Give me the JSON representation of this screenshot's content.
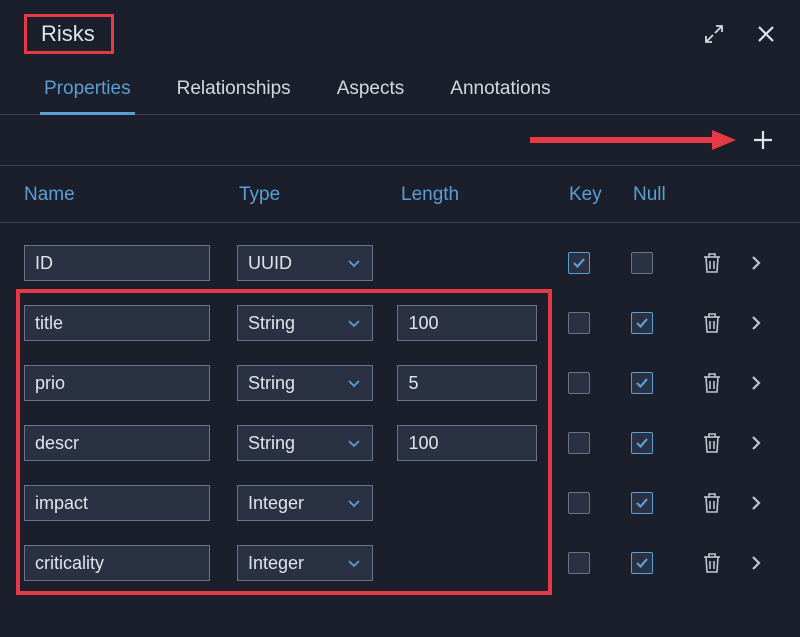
{
  "header": {
    "title": "Risks"
  },
  "tabs": [
    {
      "label": "Properties",
      "active": true
    },
    {
      "label": "Relationships",
      "active": false
    },
    {
      "label": "Aspects",
      "active": false
    },
    {
      "label": "Annotations",
      "active": false
    }
  ],
  "columns": {
    "name": "Name",
    "type": "Type",
    "length": "Length",
    "key": "Key",
    "null": "Null"
  },
  "rows": [
    {
      "name": "ID",
      "type": "UUID",
      "length": "",
      "key": true,
      "null": false
    },
    {
      "name": "title",
      "type": "String",
      "length": "100",
      "key": false,
      "null": true
    },
    {
      "name": "prio",
      "type": "String",
      "length": "5",
      "key": false,
      "null": true
    },
    {
      "name": "descr",
      "type": "String",
      "length": "100",
      "key": false,
      "null": true
    },
    {
      "name": "impact",
      "type": "Integer",
      "length": "",
      "key": false,
      "null": true
    },
    {
      "name": "criticality",
      "type": "Integer",
      "length": "",
      "key": false,
      "null": true
    }
  ]
}
